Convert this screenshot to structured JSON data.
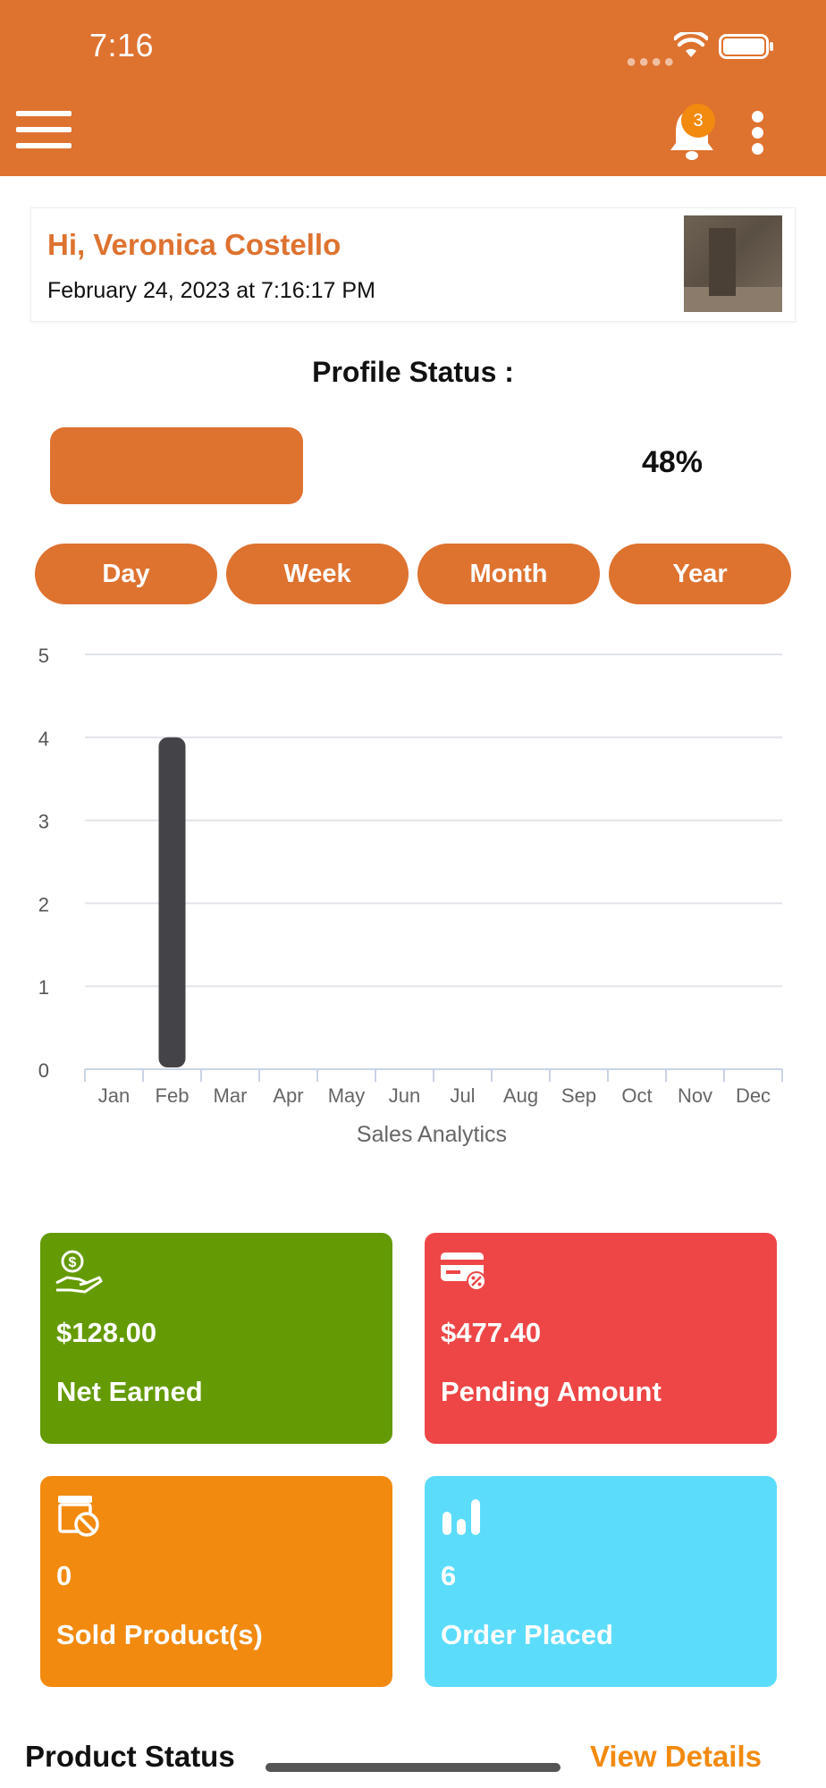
{
  "status_bar": {
    "time": "7:16"
  },
  "header": {
    "notification_count": "3",
    "accent": "#DE722F"
  },
  "greeting": {
    "name": "Hi, Veronica Costello",
    "datetime": "February 24, 2023 at 7:16:17 PM"
  },
  "profile": {
    "title": "Profile Status :",
    "percent_label": "48%",
    "progress": 0.48
  },
  "period_tabs": [
    {
      "label": "Day",
      "active": false
    },
    {
      "label": "Week",
      "active": false
    },
    {
      "label": "Month",
      "active": false
    },
    {
      "label": "Year",
      "active": true
    }
  ],
  "chart_data": {
    "type": "bar",
    "title": "",
    "xlabel": "Sales Analytics",
    "ylabel": "",
    "categories": [
      "Jan",
      "Feb",
      "Mar",
      "Apr",
      "May",
      "Jun",
      "Jul",
      "Aug",
      "Sep",
      "Oct",
      "Nov",
      "Dec"
    ],
    "values": [
      0,
      4,
      0,
      0,
      0,
      0,
      0,
      0,
      0,
      0,
      0,
      0
    ],
    "ylim": [
      0,
      5
    ],
    "yticks": [
      0,
      1,
      2,
      3,
      4,
      5
    ],
    "grid": true,
    "bar_color": "#444448"
  },
  "stats": [
    {
      "value": "$128.00",
      "label": "Net Earned",
      "color": "#649A04",
      "icon": "money-hand-icon"
    },
    {
      "value": "$477.40",
      "label": "Pending Amount",
      "color": "#EE4646",
      "icon": "card-percent-icon"
    },
    {
      "value": "0",
      "label": "Sold Product(s)",
      "color": "#F28A10",
      "icon": "product-cancel-icon"
    },
    {
      "value": "6",
      "label": "Order Placed",
      "color": "#5CDCFB",
      "icon": "bar-chart-icon"
    }
  ],
  "product_status": {
    "title": "Product Status",
    "link": "View Details"
  }
}
